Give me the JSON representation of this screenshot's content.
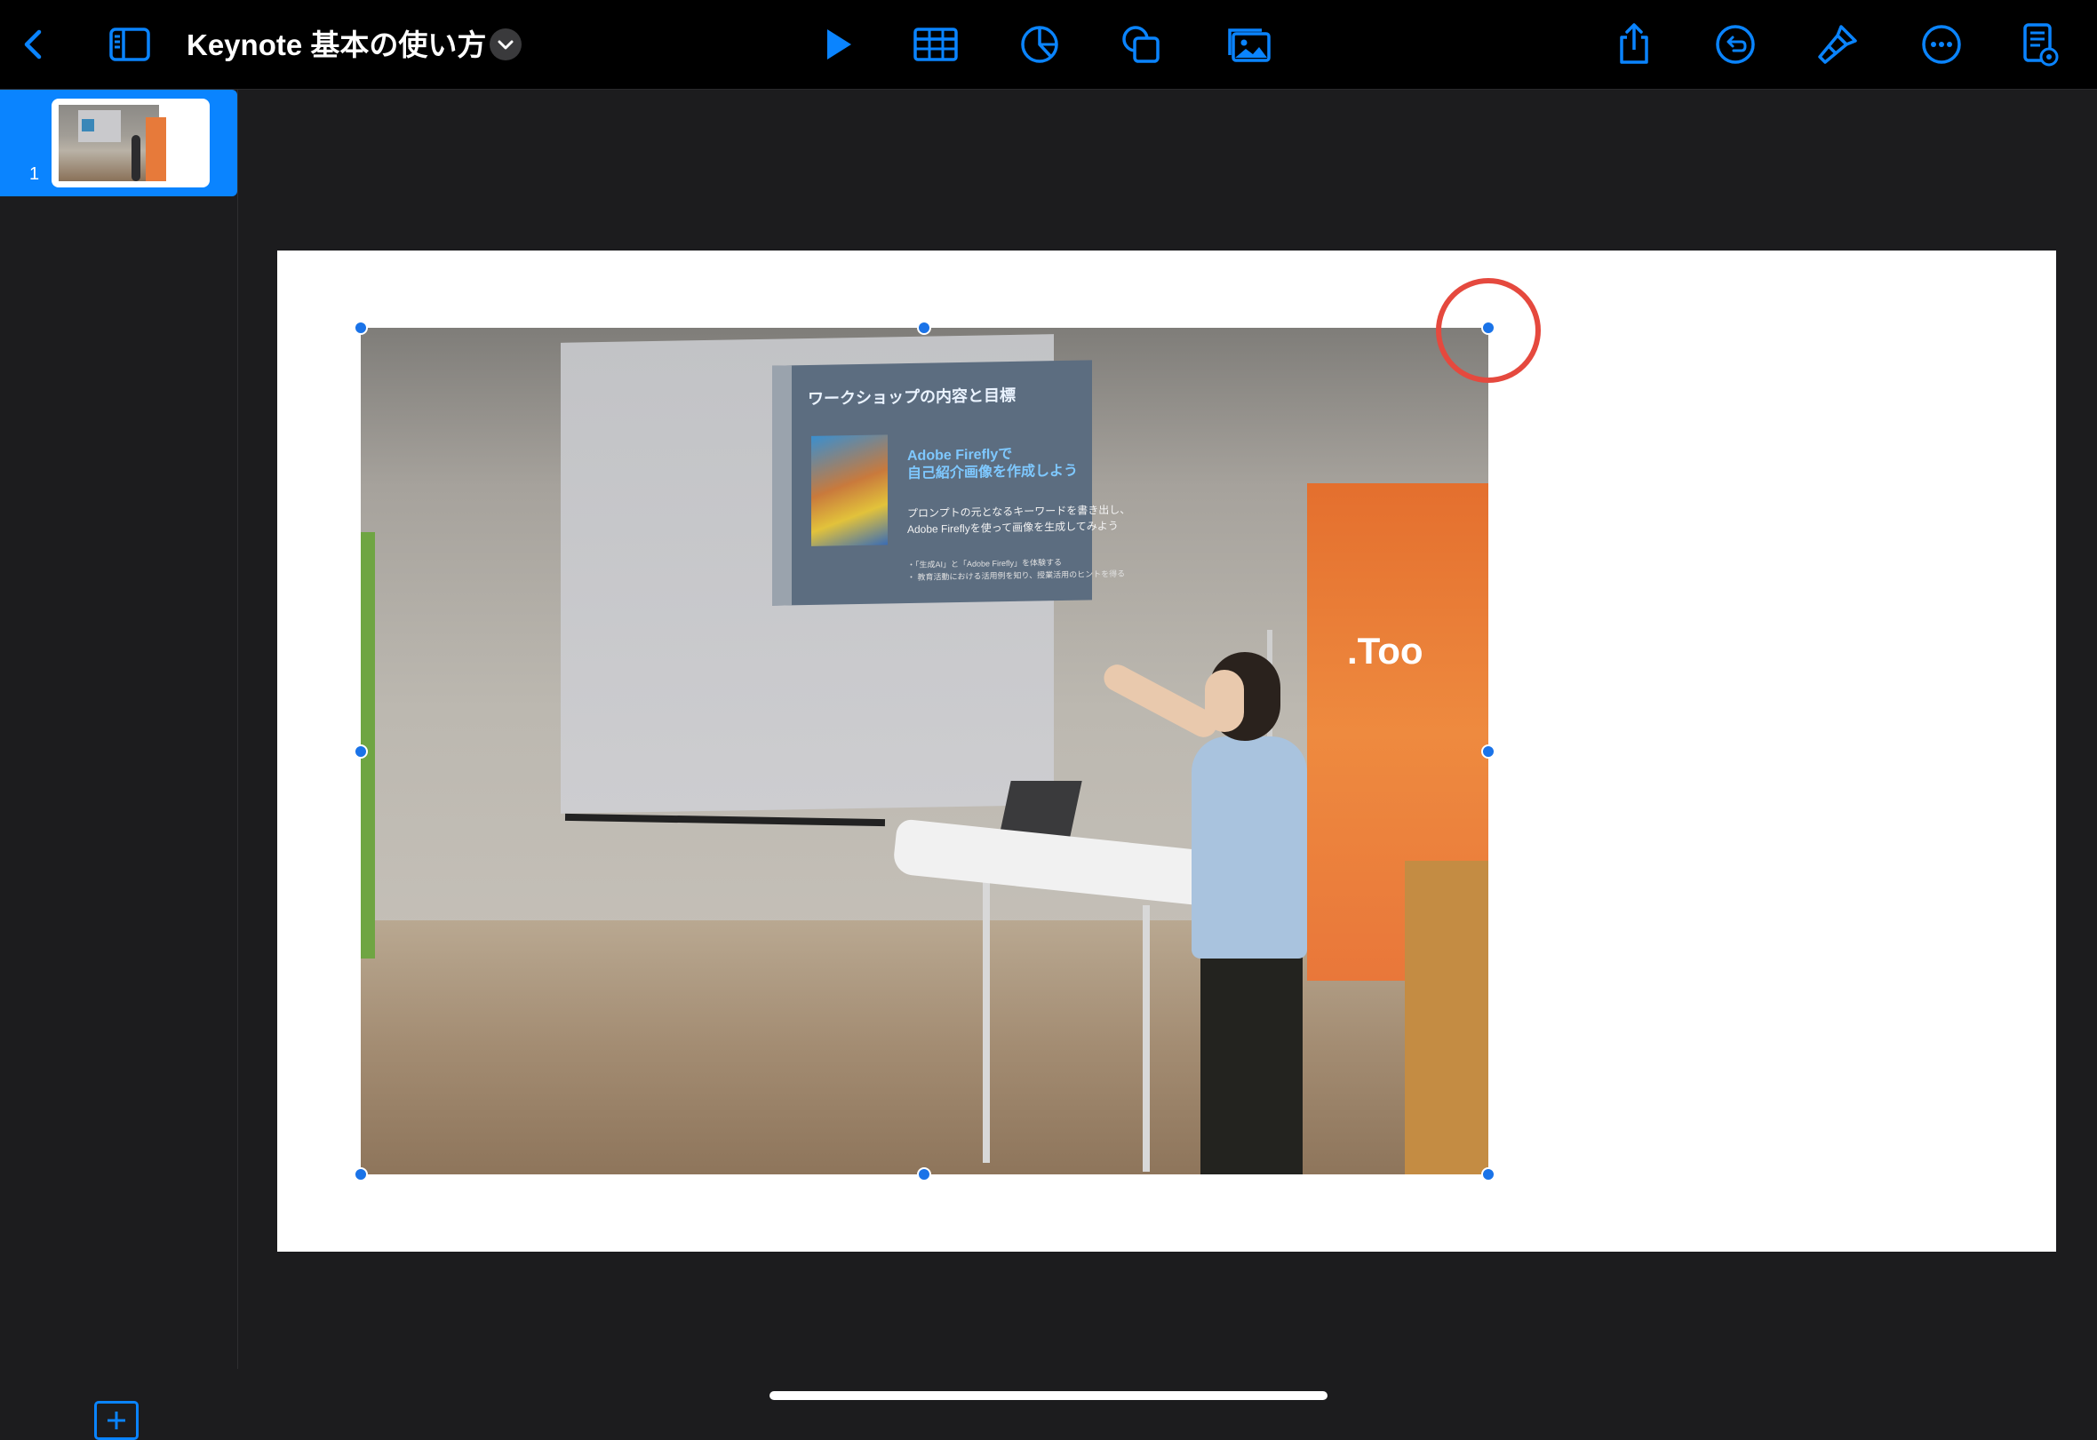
{
  "toolbar": {
    "back_label": "Back",
    "sidebar_toggle_label": "Toggle slide navigator",
    "document_title": "Keynote 基本の使い方",
    "title_menu_label": "Document options",
    "icons": {
      "back": "chevron-left-icon",
      "sidebar": "sidebar-icon",
      "title_menu": "chevron-down-icon",
      "play": "play-icon",
      "table": "table-icon",
      "chart": "chart-icon",
      "shape": "shape-icon",
      "media": "media-icon",
      "share": "share-icon",
      "undo": "undo-icon",
      "format": "paintbrush-icon",
      "more": "more-icon",
      "presenter": "presenter-view-icon"
    }
  },
  "navigator": {
    "slides": [
      {
        "number": "1",
        "selected": true
      }
    ],
    "add_slide_label": "Add slide"
  },
  "slide": {
    "photo": {
      "screen_title": "ワークショップの内容と目標",
      "screen_heading_1": "Adobe Fireflyで",
      "screen_heading_2": "自己紹介画像を作成しよう",
      "screen_body_1": "プロンプトの元となるキーワードを書き出し、",
      "screen_body_2": "Adobe Fireflyを使って画像を生成してみよう",
      "screen_bullet_1": "・「生成AI」と「Adobe Firefly」を体験する",
      "screen_bullet_2": "・ 教育活動における活用例を知り、授業活用のヒントを得る",
      "banner_text": ".Too"
    },
    "selection": {
      "selected": true
    }
  },
  "annotation": {
    "highlight": "top-right-resize-handle"
  },
  "colors": {
    "accent": "#0a84ff",
    "toolbar_bg": "#000000",
    "app_bg": "#1c1c1e",
    "handle": "#1a73e8",
    "highlight": "#e5493e"
  }
}
